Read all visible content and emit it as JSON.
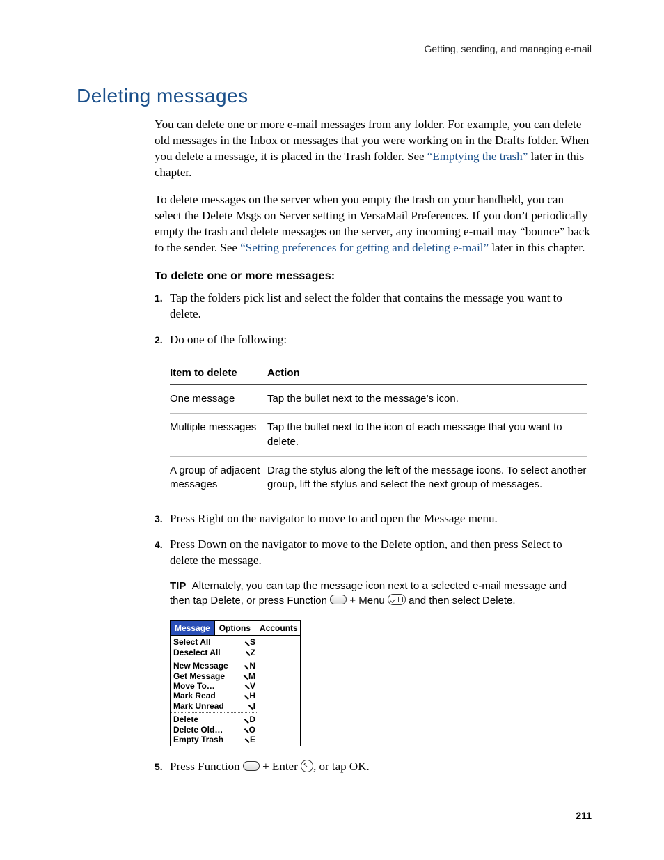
{
  "running_header": "Getting, sending, and managing e-mail",
  "section_title": "Deleting messages",
  "para1_a": "You can delete one or more e-mail messages from any folder. For example, you can delete old messages in the Inbox or messages that you were working on in the Drafts folder. When you delete a message, it is placed in the Trash folder. See ",
  "para1_link": "“Emptying the trash”",
  "para1_b": " later in this chapter.",
  "para2_a": "To delete messages on the server when you empty the trash on your handheld, you can select the Delete Msgs on Server setting in VersaMail Preferences. If you don’t periodically empty the trash and delete messages on the server, any incoming e-mail may “bounce” back to the sender. See ",
  "para2_link": "“Setting preferences for getting and deleting e-mail”",
  "para2_b": " later in this chapter.",
  "proc_title": "To delete one or more messages:",
  "steps": {
    "s1": "Tap the folders pick list and select the folder that contains the message you want to delete.",
    "s2": "Do one of the following:",
    "s3": "Press Right on the navigator to move to and open the Message menu.",
    "s4": "Press Down on the navigator to move to the Delete option, and then press Select to delete the message.",
    "s5_a": "Press Function ",
    "s5_b": " + Enter ",
    "s5_c": ", or tap OK."
  },
  "table": {
    "h1": "Item to delete",
    "h2": "Action",
    "rows": [
      {
        "c1": "One message",
        "c2": "Tap the bullet next to the message’s icon."
      },
      {
        "c1": "Multiple messages",
        "c2": "Tap the bullet next to the icon of each message that you want to delete."
      },
      {
        "c1": "A group of adjacent messages",
        "c2": "Drag the stylus along the left of the message icons. To select another group, lift the stylus and select the next group of messages."
      }
    ]
  },
  "tip": {
    "label": "TIP",
    "a": "Alternately, you can tap the message icon next to a selected e-mail message and then tap Delete, or press Function ",
    "b": " + Menu ",
    "c": " and then select Delete."
  },
  "palm": {
    "tabs": [
      "Message",
      "Options",
      "Accounts"
    ],
    "group1": [
      {
        "label": "Select All",
        "sc": "S"
      },
      {
        "label": "Deselect All",
        "sc": "Z"
      }
    ],
    "group2": [
      {
        "label": "New Message",
        "sc": "N"
      },
      {
        "label": "Get Message",
        "sc": "M"
      },
      {
        "label": "Move To…",
        "sc": "V"
      },
      {
        "label": "Mark Read",
        "sc": "H"
      },
      {
        "label": "Mark Unread",
        "sc": "I"
      }
    ],
    "group3": [
      {
        "label": "Delete",
        "sc": "D"
      },
      {
        "label": "Delete Old…",
        "sc": "O"
      },
      {
        "label": "Empty Trash",
        "sc": "E"
      }
    ]
  },
  "page_number": "211"
}
